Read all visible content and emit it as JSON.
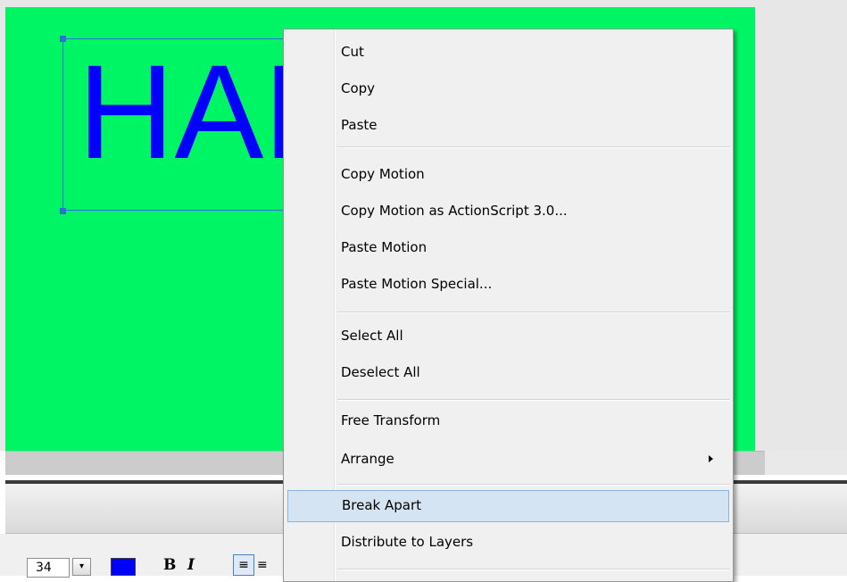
{
  "stage": {
    "background_color": "#00f565",
    "text_object": {
      "text": "HAR",
      "color": "#0000ff"
    }
  },
  "properties": {
    "font_size": "34",
    "dropdown_glyph": "▾",
    "text_color": "#0000ff",
    "bold_label": "B",
    "italic_label": "I",
    "align_left_glyph": "≡",
    "align_center_glyph": "≡"
  },
  "context_menu": {
    "items": [
      {
        "label": "Cut"
      },
      {
        "label": "Copy"
      },
      {
        "label": "Paste"
      },
      {
        "label": "Copy Motion"
      },
      {
        "label": "Copy Motion as ActionScript 3.0..."
      },
      {
        "label": "Paste Motion"
      },
      {
        "label": "Paste Motion Special..."
      },
      {
        "label": "Select All"
      },
      {
        "label": "Deselect All"
      },
      {
        "label": "Free Transform"
      },
      {
        "label": "Arrange",
        "has_submenu": true
      },
      {
        "label": "Break Apart",
        "highlighted": true
      },
      {
        "label": "Distribute to Layers"
      }
    ]
  }
}
